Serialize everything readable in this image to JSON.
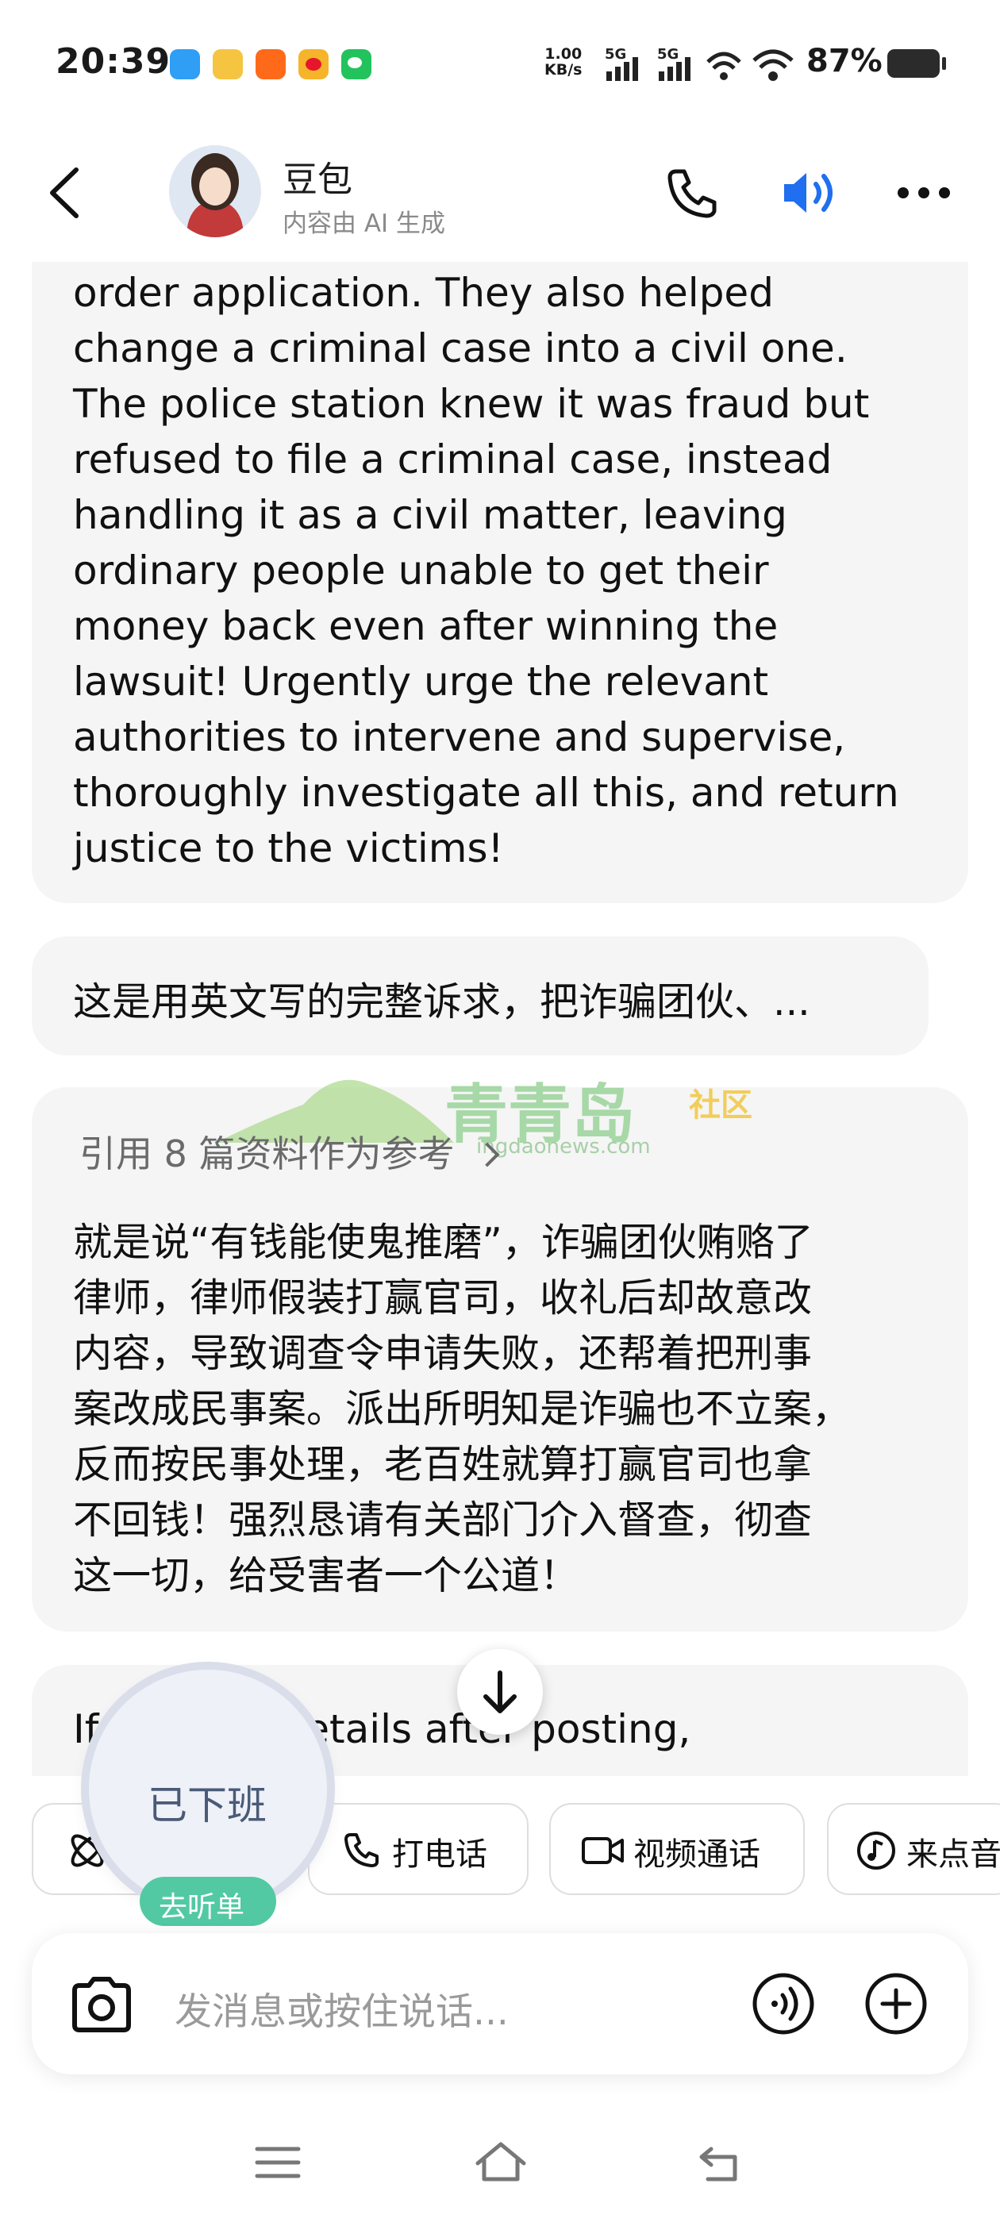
{
  "status_bar": {
    "time": "20:39",
    "net_speed_value": "1.00",
    "net_speed_unit": "KB/s",
    "signal_1": "5G",
    "signal_2": "5G",
    "battery": "87%",
    "app_icons": [
      "app-blue-icon",
      "pet-icon",
      "taobao-icon",
      "weibo-icon",
      "wechat-icon"
    ]
  },
  "header": {
    "name": "豆包",
    "subtitle": "内容由 AI 生成",
    "icons": [
      "back-arrow-icon",
      "phone-icon",
      "speaker-icon",
      "more-icon"
    ],
    "accent_color": "#1f6ff0"
  },
  "messages": {
    "bot_en_top": "order application. They also helped\nchange a criminal case into a civil one.\nThe police station knew it was fraud but\nrefused to file a criminal case, instead\nhandling it as a civil matter, leaving\nordinary people unable to get their\nmoney back even after winning the\nlawsuit! Urgently urge the relevant\nauthorities to intervene and supervise,\nthoroughly investigate all this, and return\njustice to the victims!",
    "user": "这是用英文写的完整诉求，把诈骗团伙、...",
    "refs": "引用 8 篇资料作为参考",
    "bot_zh": "就是说“有钱能使鬼推磨”，诈骗团伙贿赂了\n律师，律师假装打赢官司，收礼后却故意改\n内容，导致调查令申请失败，还帮着把刑事\n案改成民事案。派出所明知是诈骗也不立案，\n反而按民事处理，老百姓就算打赢官司也拿\n不回钱！强烈恳请有关部门介入督查，彻查\n这一切，给受害者一个公道！",
    "bot_en_bottom": "If        asks for details after posting,"
  },
  "watermark": {
    "text": "青青岛",
    "sub": "社区",
    "url": "ingdaonews.com"
  },
  "chips": [
    {
      "icon": "atom-icon",
      "label": ""
    },
    {
      "icon": "phone-icon",
      "label": "打电话"
    },
    {
      "icon": "video-icon",
      "label": "视频通话"
    },
    {
      "icon": "music-note-icon",
      "label": "来点音"
    }
  ],
  "floating_badge": {
    "label": "已下班",
    "pill": "去听单",
    "pill_color": "#52c9a2"
  },
  "input": {
    "placeholder": "发消息或按住说话...",
    "icons": [
      "camera-icon",
      "voice-wave-icon",
      "plus-icon"
    ]
  },
  "nav_bar": {
    "icons": [
      "menu-icon",
      "home-icon",
      "back-icon"
    ]
  }
}
